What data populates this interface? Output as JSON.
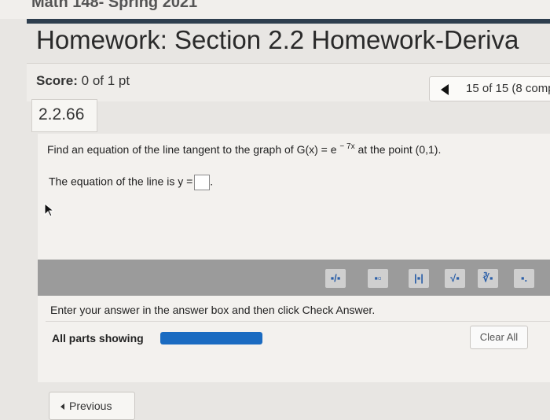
{
  "header": {
    "course_title": "Math 148- Spring 2021",
    "homework_title": "Homework: Section 2.2 Homework-Deriva"
  },
  "score": {
    "label": "Score:",
    "value": "0 of 1 pt"
  },
  "pager": {
    "text": "15 of 15 (8 comp"
  },
  "problem": {
    "number": "2.2.66",
    "question_prefix": "Find an equation of the line tangent to the graph of G(x) = e",
    "question_exponent": "− 7x",
    "question_suffix": " at the point (0,1).",
    "answer_prefix": "The equation of the line is y =",
    "answer_suffix": "."
  },
  "toolbar": {
    "buttons": [
      {
        "name": "fraction-tool-icon",
        "glyph": "▪/▪"
      },
      {
        "name": "exponent-tool-icon",
        "glyph": "▪▫"
      },
      {
        "name": "absolute-value-tool-icon",
        "glyph": "|▪|"
      },
      {
        "name": "sqrt-tool-icon",
        "glyph": "√▪"
      },
      {
        "name": "nth-root-tool-icon",
        "glyph": "∛▪"
      },
      {
        "name": "decimal-tool-icon",
        "glyph": "▪."
      }
    ]
  },
  "footer": {
    "instruction": "Enter your answer in the answer box and then click Check Answer.",
    "parts_label": "All parts showing",
    "progress_fraction": 1.0,
    "clear_label": "Clear All",
    "previous_label": "Previous"
  }
}
